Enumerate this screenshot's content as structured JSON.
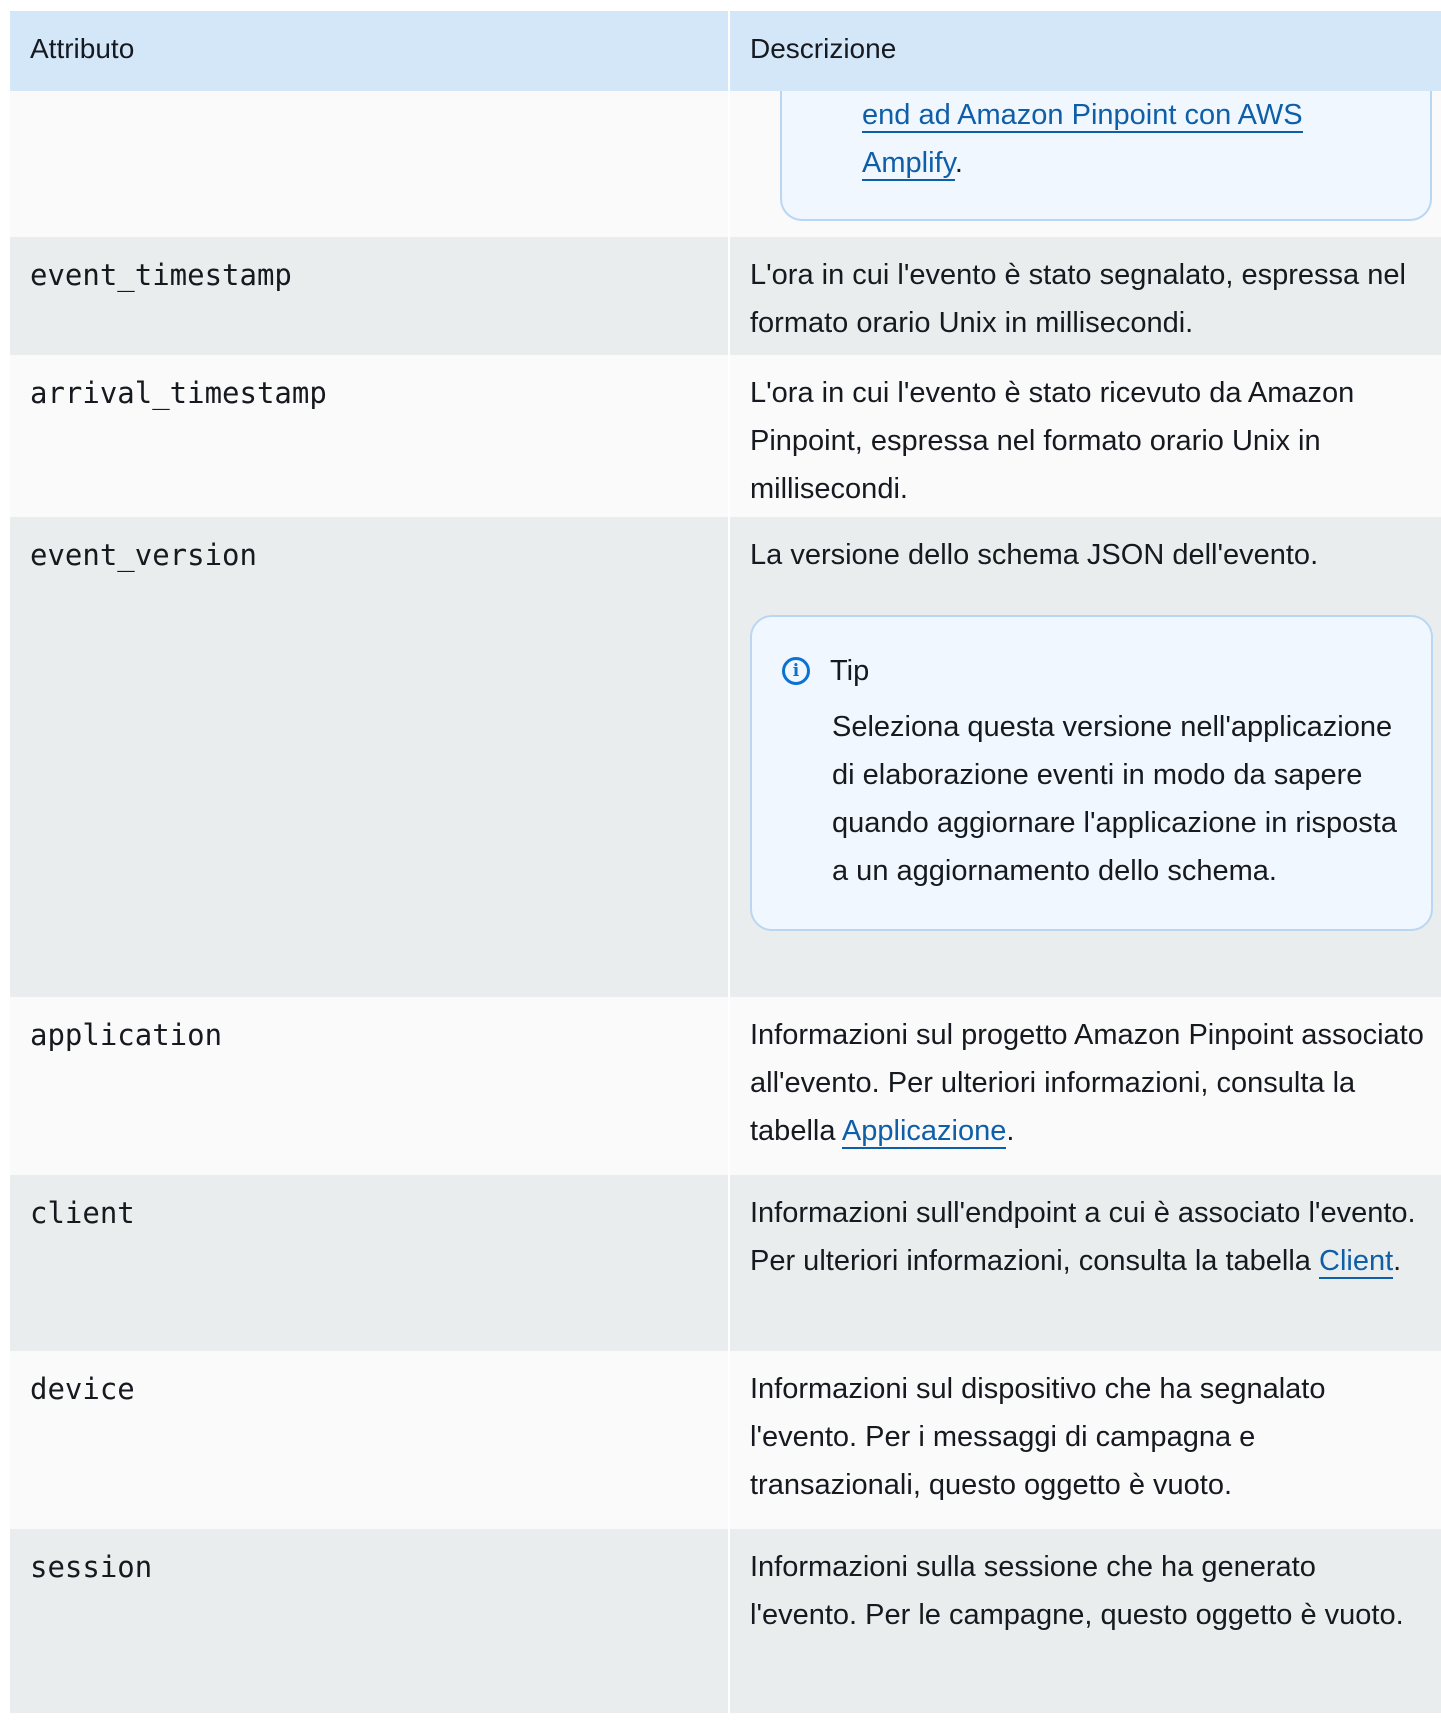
{
  "table": {
    "headers": {
      "attribute": "Attributo",
      "description": "Descrizione"
    },
    "continued_note": {
      "link_text": "end ad Amazon Pinpoint con AWS Amplify",
      "suffix": "."
    },
    "rows": [
      {
        "attribute": "event_timestamp",
        "description": "L'ora in cui l'evento è stato segnalato, espressa nel formato orario Unix in millisecondi."
      },
      {
        "attribute": "arrival_timestamp",
        "description": "L'ora in cui l'evento è stato ricevuto da Amazon Pinpoint, espressa nel formato orario Unix in millisecondi."
      },
      {
        "attribute": "event_version",
        "description": "La versione dello schema JSON dell'evento.",
        "tip": {
          "title": "Tip",
          "body": "Seleziona questa versione nell'applicazione di elaborazione eventi in modo da sapere quando aggiornare l'applicazione in risposta a un aggiornamento dello schema."
        }
      },
      {
        "attribute": "application",
        "description_prefix": "Informazioni sul progetto Amazon Pinpoint associato all'evento. Per ulteriori informazioni, consulta la tabella ",
        "link_text": "Applicazione",
        "suffix": "."
      },
      {
        "attribute": "client",
        "description_prefix": "Informazioni sull'endpoint a cui è associato l'evento. Per ulteriori informazioni, consulta la tabella ",
        "link_text": "Client",
        "suffix": "."
      },
      {
        "attribute": "device",
        "description": "Informazioni sul dispositivo che ha segnalato l'evento. Per i messaggi di campagna e transazionali, questo oggetto è vuoto."
      },
      {
        "attribute": "session",
        "description": "Informazioni sulla sessione che ha generato l'evento. Per le campagne, questo oggetto è vuoto."
      }
    ]
  }
}
